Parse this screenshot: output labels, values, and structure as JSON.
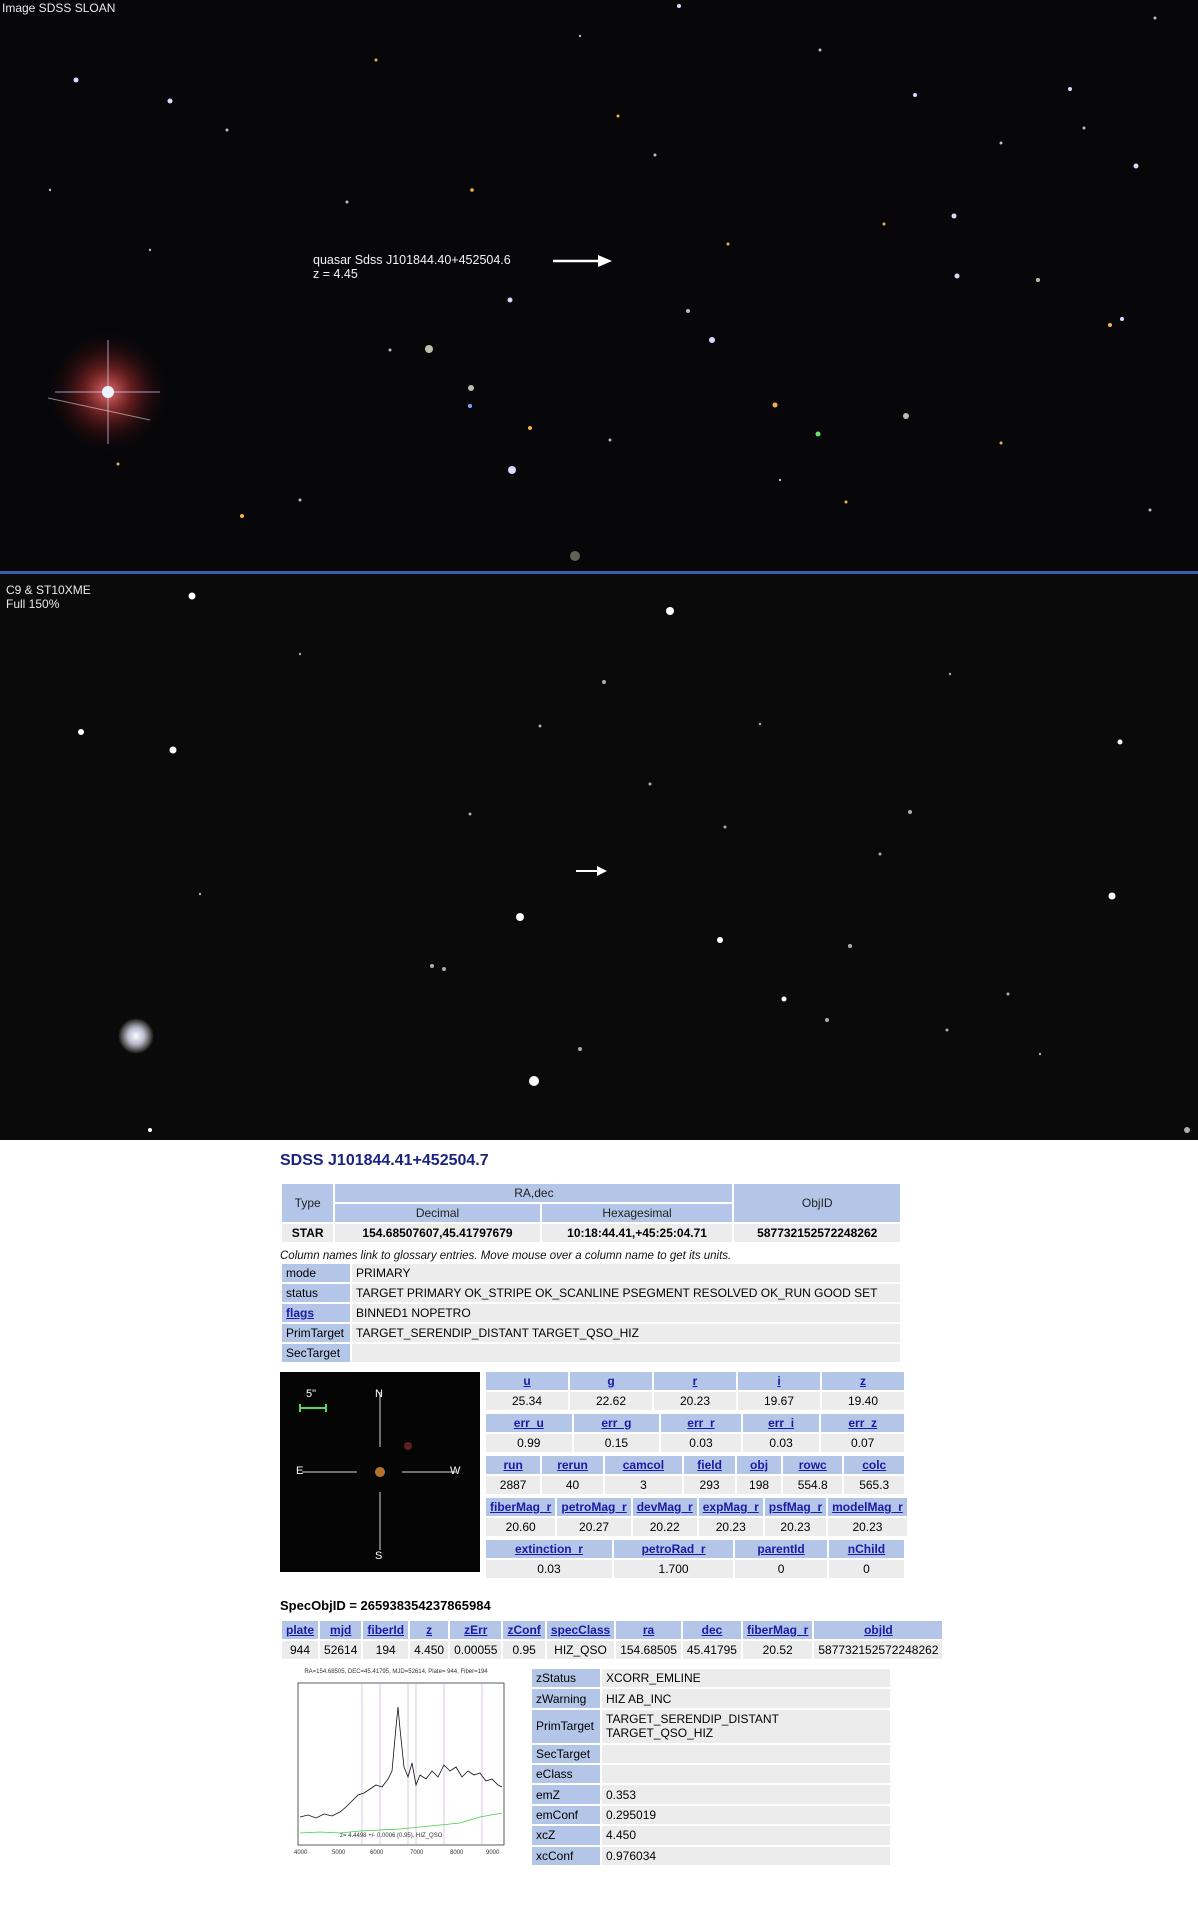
{
  "top_panel": {
    "label": "Image SDSS SLOAN",
    "annotation_line1": "quasar Sdss J101844.40+452504.6",
    "annotation_line2": "z = 4.45"
  },
  "bottom_panel": {
    "label_line1": "C9 & ST10XME",
    "label_line2": "Full 150%"
  },
  "object": {
    "title": "SDSS J101844.41+452504.7",
    "summary_headers": {
      "type": "Type",
      "radec": "RA,dec",
      "decimal": "Decimal",
      "hexagesimal": "Hexagesimal",
      "objid": "ObjID"
    },
    "summary_values": {
      "type": "STAR",
      "decimal": "154.68507607,45.41797679",
      "hexagesimal": "10:18:44.41,+45:25:04.71",
      "objid": "587732152572248262"
    },
    "note": "Column names link to glossary entries. Move mouse over a column name to get its units.",
    "flags_rows": [
      {
        "name": "mode",
        "value": "PRIMARY",
        "link": false
      },
      {
        "name": "status",
        "value": "TARGET PRIMARY OK_STRIPE OK_SCANLINE PSEGMENT RESOLVED OK_RUN GOOD SET",
        "link": false
      },
      {
        "name": "flags",
        "value": "BINNED1 NOPETRO",
        "link": true
      },
      {
        "name": "PrimTarget",
        "value": "TARGET_SERENDIP_DISTANT TARGET_QSO_HIZ",
        "link": false
      },
      {
        "name": "SecTarget",
        "value": "",
        "link": false
      }
    ],
    "finder": {
      "scale": "5\"",
      "n": "N",
      "s": "S",
      "e": "E",
      "w": "W"
    },
    "mags": {
      "h1": [
        "u",
        "g",
        "r",
        "i",
        "z"
      ],
      "v1": [
        "25.34",
        "22.62",
        "20.23",
        "19.67",
        "19.40"
      ],
      "h2": [
        "err_u",
        "err_g",
        "err_r",
        "err_i",
        "err_z"
      ],
      "v2": [
        "0.99",
        "0.15",
        "0.03",
        "0.03",
        "0.07"
      ],
      "h3": [
        "run",
        "rerun",
        "camcol",
        "field",
        "obj",
        "rowc",
        "colc"
      ],
      "v3": [
        "2887",
        "40",
        "3",
        "293",
        "198",
        "554.8",
        "565.3"
      ],
      "h4": [
        "fiberMag_r",
        "petroMag_r",
        "devMag_r",
        "expMag_r",
        "psfMag_r",
        "modelMag_r"
      ],
      "v4": [
        "20.60",
        "20.27",
        "20.22",
        "20.23",
        "20.23",
        "20.23"
      ],
      "h5": [
        "extinction_r",
        "petroRad_r",
        "parentId",
        "nChild"
      ],
      "v5": [
        "0.03",
        "1.700",
        "0",
        "0"
      ]
    },
    "spec": {
      "title": "SpecObjID = 265938354237865984",
      "headers": [
        "plate",
        "mjd",
        "fiberId",
        "z",
        "zErr",
        "zConf",
        "specClass",
        "ra",
        "dec",
        "fiberMag_r",
        "objId"
      ],
      "values": [
        "944",
        "52614",
        "194",
        "4.450",
        "0.00055",
        "0.95",
        "HIZ_QSO",
        "154.68505",
        "45.41795",
        "20.52",
        "587732152572248262"
      ],
      "plot_caption": "RA=154.68505, DEC=45.41795, MJD=52614, Plate= 944, Fiber=194",
      "plot_footer": "z= 4.4498 +/- 0.0006 (0.95), HIZ_QSO",
      "details": [
        {
          "name": "zStatus",
          "value": "XCORR_EMLINE"
        },
        {
          "name": "zWarning",
          "value": "HIZ AB_INC"
        },
        {
          "name": "PrimTarget",
          "value": "TARGET_SERENDIP_DISTANT TARGET_QSO_HIZ"
        },
        {
          "name": "SecTarget",
          "value": ""
        },
        {
          "name": "eClass",
          "value": ""
        },
        {
          "name": "emZ",
          "value": "0.353"
        },
        {
          "name": "emConf",
          "value": "0.295019"
        },
        {
          "name": "xcZ",
          "value": "4.450"
        },
        {
          "name": "xcConf",
          "value": "0.976034"
        }
      ]
    }
  }
}
